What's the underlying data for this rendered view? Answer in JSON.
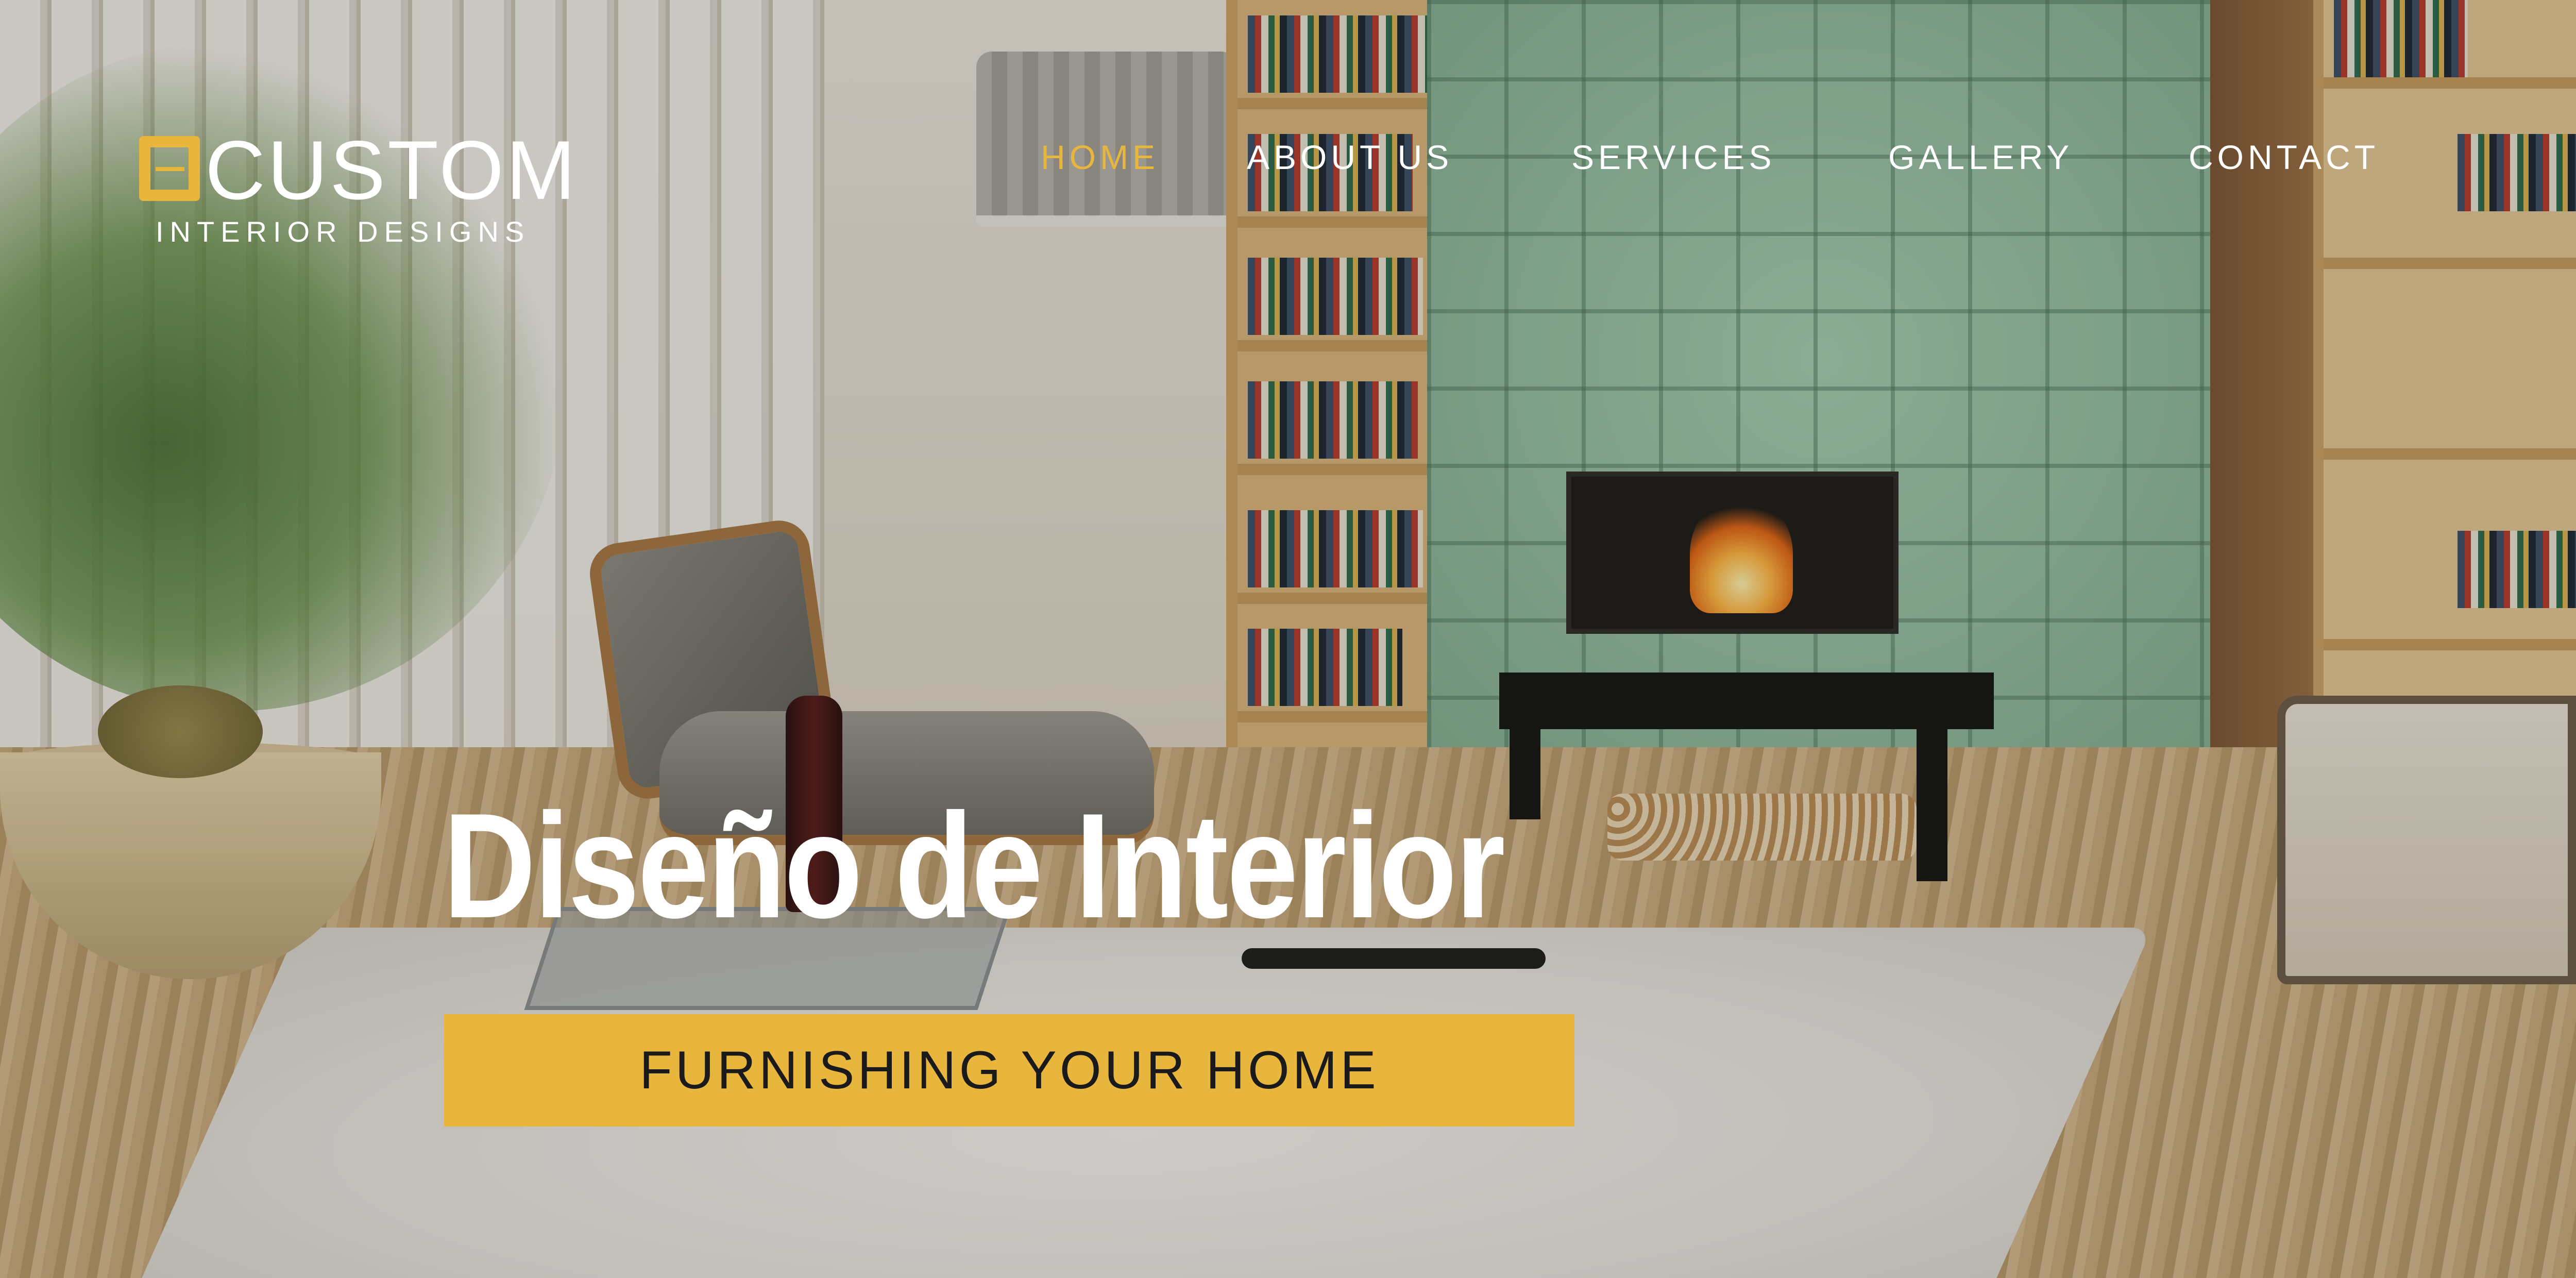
{
  "brand": {
    "name": "CUSTOM",
    "tagline": "INTERIOR DESIGNS",
    "accent_color": "#e8b53d"
  },
  "nav": {
    "items": [
      {
        "label": "HOME",
        "active": true
      },
      {
        "label": "ABOUT US",
        "active": false
      },
      {
        "label": "SERVICES",
        "active": false
      },
      {
        "label": "GALLERY",
        "active": false
      },
      {
        "label": "CONTACT",
        "active": false
      }
    ]
  },
  "hero": {
    "title": "Diseño de Interior",
    "cta_label": "FURNISHING YOUR HOME",
    "background_image": "living-room-photo"
  }
}
